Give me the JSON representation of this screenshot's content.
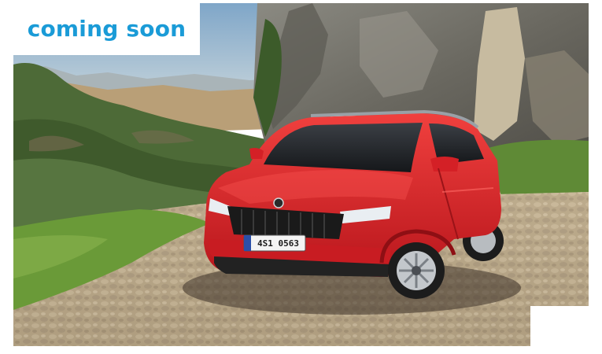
{
  "banner": {
    "status_label": "coming soon"
  },
  "photo": {
    "subject": "red-compact-suv",
    "license_plate": "4S1 0563"
  },
  "colors": {
    "accent": "#1a9bd7",
    "car_body": "#e0262a",
    "sky": "#8fb2cf"
  }
}
